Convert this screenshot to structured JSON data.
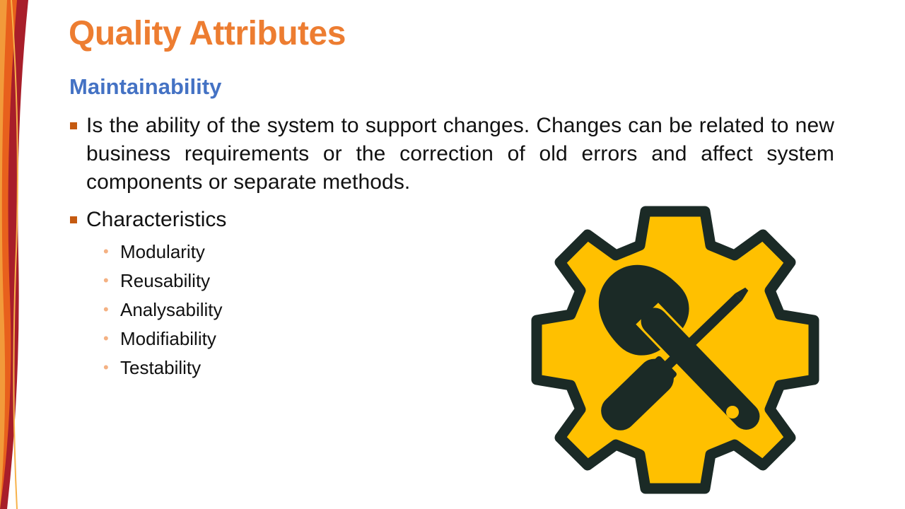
{
  "colors": {
    "title": "#ED7D31",
    "subtitle": "#4472C4",
    "bullet": "#C55A11",
    "subbullet": "#F4B183",
    "gear_fill": "#FFC000",
    "gear_outline": "#1B2A26"
  },
  "slide": {
    "title": "Quality Attributes",
    "subtitle": "Maintainability"
  },
  "bullets": [
    {
      "text": "Is the ability of the system to support changes. Changes can be related to new business requirements or the correction of old errors and affect system components or separate methods."
    },
    {
      "text": "Characteristics",
      "children": [
        "Modularity",
        "Reusability",
        "Analysability",
        "Modifiability",
        "Testability"
      ]
    }
  ],
  "icons": {
    "main_graphic": "gear-wrench-screwdriver-icon"
  }
}
